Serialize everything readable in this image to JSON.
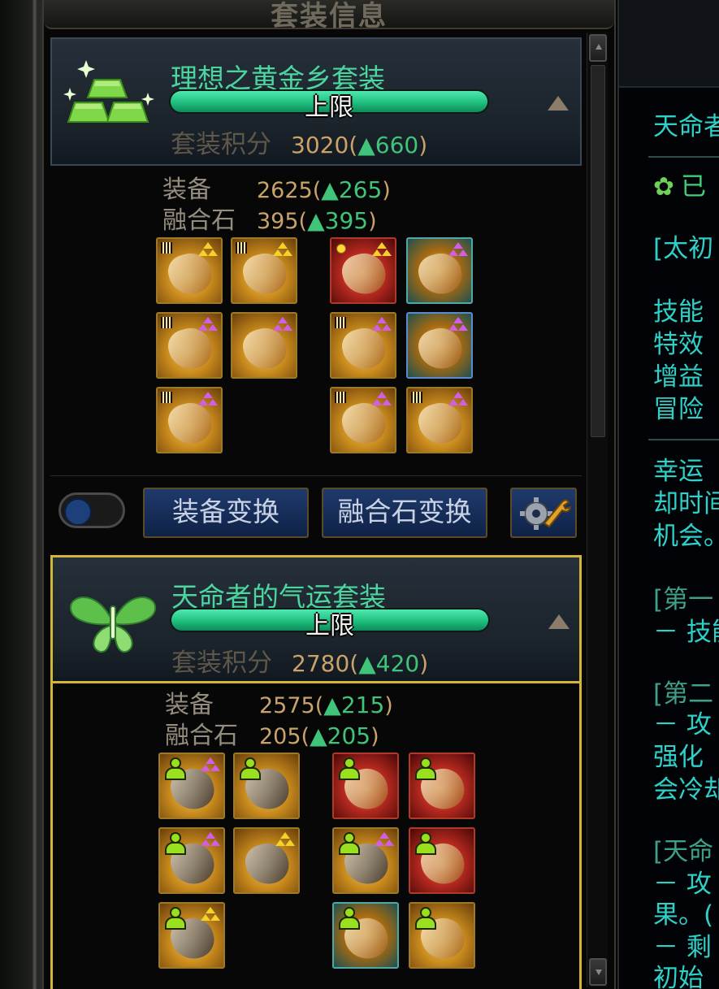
{
  "panel": {
    "title": "套装信息"
  },
  "sets": [
    {
      "name": "理想之黄金乡套装",
      "progress_label": "上限",
      "score_label": "套装积分",
      "score_value": "3020",
      "score_delta": "660",
      "equip_label": "装备",
      "equip_value": "2625",
      "equip_delta": "265",
      "stone_label": "融合石",
      "stone_value": "395",
      "stone_delta": "395",
      "icon": "gold-bars-icon",
      "active": false
    },
    {
      "name": "天命者的气运套装",
      "progress_label": "上限",
      "score_label": "套装积分",
      "score_value": "2780",
      "score_delta": "420",
      "equip_label": "装备",
      "equip_value": "2575",
      "equip_delta": "215",
      "stone_label": "融合石",
      "stone_value": "205",
      "stone_delta": "205",
      "icon": "green-butterfly-icon",
      "active": true
    }
  ],
  "buttons": {
    "equip_swap": "装备变换",
    "stone_swap": "融合石变换"
  },
  "right_panel": {
    "lines": [
      "天命者",
      "已",
      "[太初",
      "技能",
      "特效",
      "增益",
      "冒险",
      "幸运",
      "却时间",
      "机会。",
      "[第一",
      "－ 技能",
      "[第二",
      "－ 攻",
      "强化",
      "会冷却",
      "[天命",
      "－ 攻",
      "果。(",
      "－ 剩",
      "初始"
    ]
  },
  "colors": {
    "set_name": "#4bd6a0",
    "progress": "#1fbf7f",
    "active_border": "#d4b43a",
    "button_bg": "#1f3a6c"
  }
}
